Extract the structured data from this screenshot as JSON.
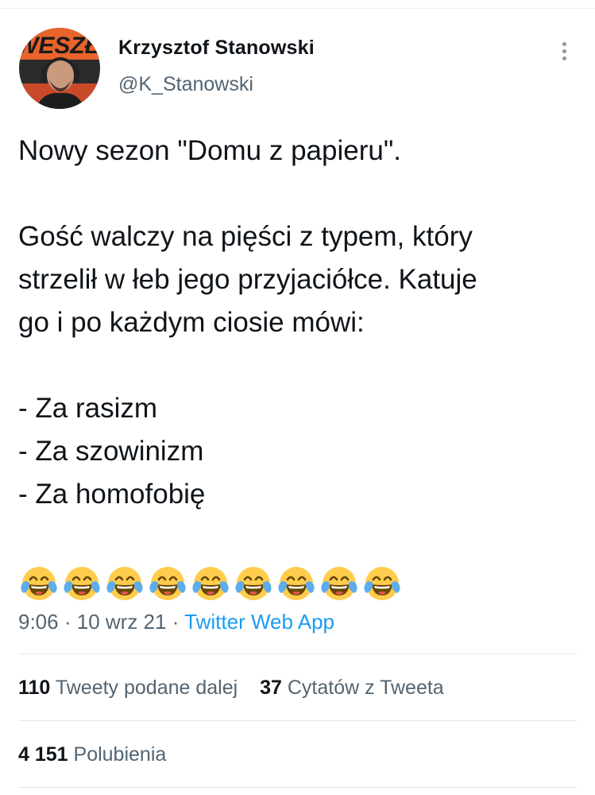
{
  "tweet": {
    "author": {
      "name": "Krzysztof Stanowski",
      "handle": "@K_Stanowski",
      "avatar_text": "WESZŁO"
    },
    "text_lines": [
      "Nowy sezon \"Domu z papieru\".",
      "",
      "Gość walczy na pięści z typem, który",
      "strzelił w łeb jego przyjaciółce. Katuje",
      "go i po każdym ciosie mówi:",
      "",
      "- Za rasizm",
      "- Za szowinizm",
      "- Za homofobię"
    ],
    "emoji": {
      "name": "face-with-tears-of-joy",
      "count": 9
    },
    "time": "9:06",
    "separator": "·",
    "date": "10 wrz 21",
    "source": "Twitter Web App"
  },
  "stats": {
    "retweets": {
      "count": "110",
      "label": "Tweety podane dalej"
    },
    "quotes": {
      "count": "37",
      "label": "Cytatów z Tweeta"
    },
    "likes": {
      "count": "4 151",
      "label": "Polubienia"
    }
  },
  "colors": {
    "text": "#0f1419",
    "secondary": "#536471",
    "link": "#1d9bf0",
    "divider": "#e1e8ed"
  }
}
